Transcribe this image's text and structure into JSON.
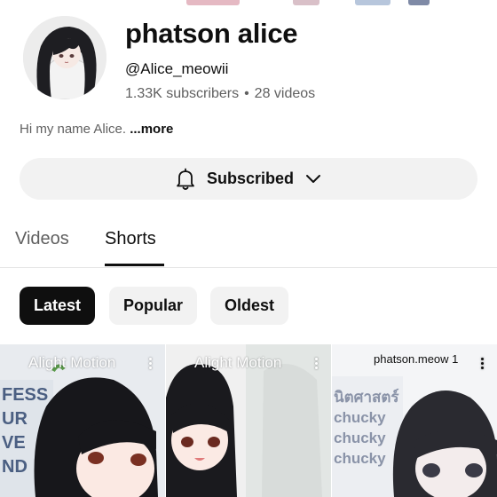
{
  "channel": {
    "name": "phatson alice",
    "handle": "@Alice_meowii",
    "subscribers": "1.33K subscribers",
    "separator": "•",
    "videos": "28 videos",
    "description": "Hi my name Alice.",
    "more": "...more"
  },
  "subscribe": {
    "label": "Subscribed",
    "bell_icon": "bell-icon",
    "chevron_icon": "chevron-down-icon"
  },
  "tabs": [
    {
      "label": "Videos",
      "active": false
    },
    {
      "label": "Shorts",
      "active": true
    }
  ],
  "filters": [
    {
      "label": "Latest",
      "active": true
    },
    {
      "label": "Popular",
      "active": false
    },
    {
      "label": "Oldest",
      "active": false
    }
  ],
  "shorts": [
    {
      "overlay": "Alight Motion",
      "side_text": "FESS\nUR\nVE\nND"
    },
    {
      "overlay": "Alight Motion"
    },
    {
      "overlay": "phatson.meow 1",
      "side_text": "นิตศาสตร์\nchucky\nchucky\nchucky"
    }
  ],
  "colors": {
    "accent": "#0f0f0f",
    "chip_bg": "#f2f2f2",
    "muted": "#606060",
    "divider": "#e5e5e5"
  }
}
